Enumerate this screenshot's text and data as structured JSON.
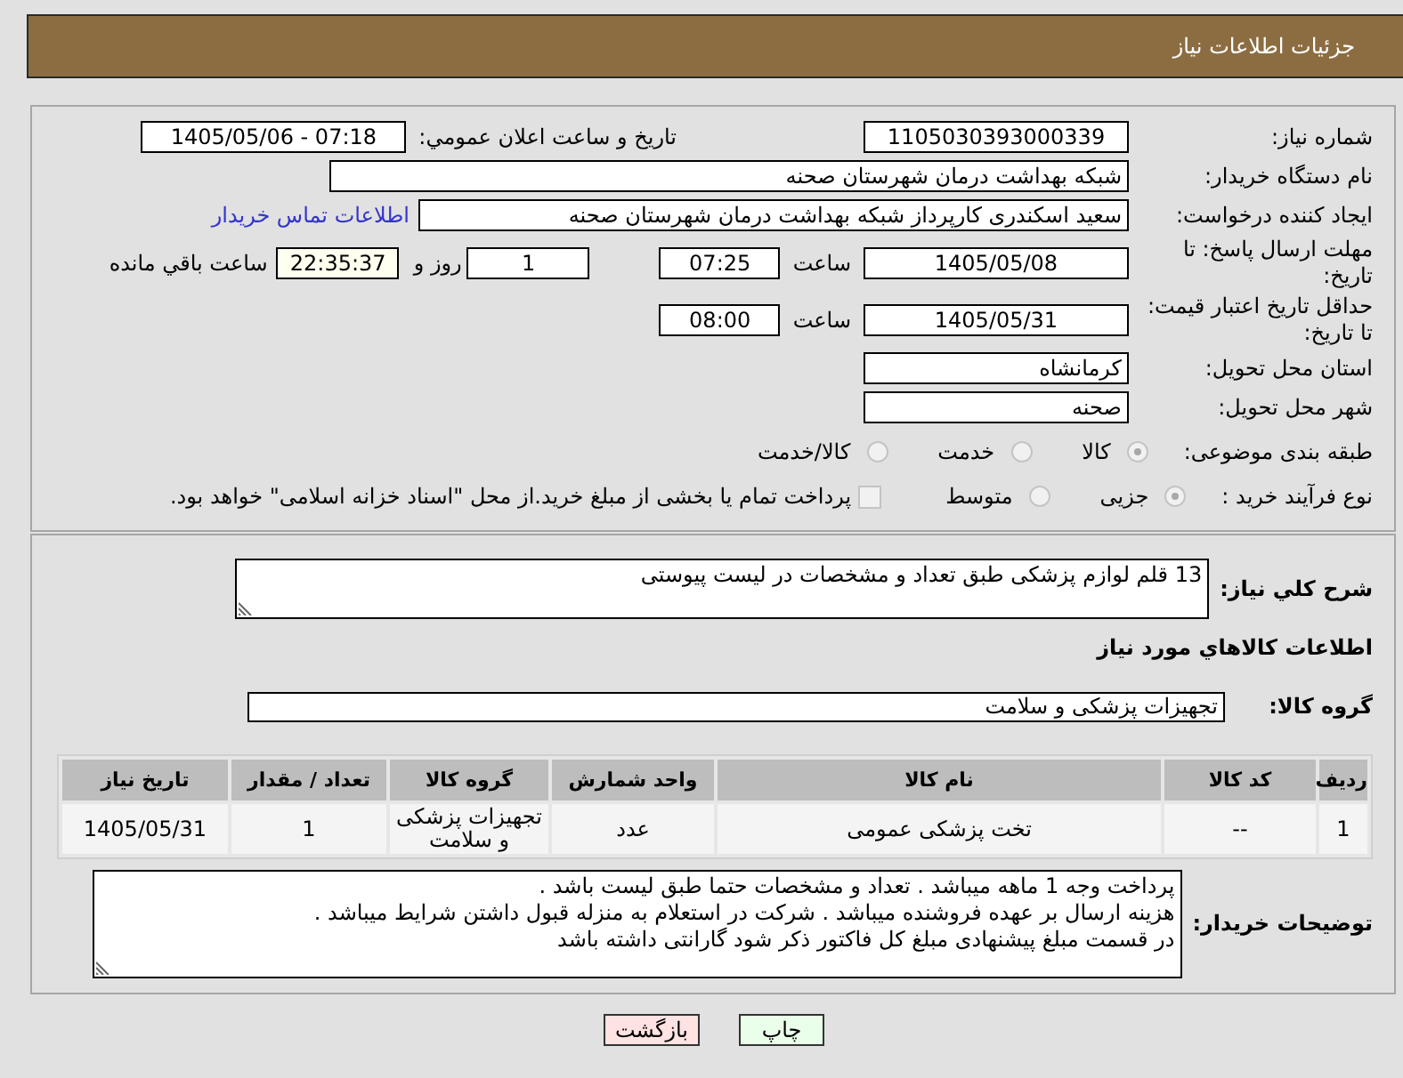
{
  "header": {
    "title": "جزئیات اطلاعات نیاز"
  },
  "need_info": {
    "need_number": {
      "label": "شماره نیاز:",
      "value": "1105030393000339"
    },
    "announcement": {
      "label": "تاریخ و ساعت اعلان عمومي:",
      "value": "1405/05/06 - 07:18"
    },
    "buyer_org": {
      "label": "نام دستگاه خریدار:",
      "value": "شبکه بهداشت درمان شهرستان صحنه"
    },
    "requester": {
      "label": "ایجاد کننده درخواست:",
      "value": "سعید اسکندری کارپرداز شبکه بهداشت درمان شهرستان صحنه",
      "contact_link": "اطلاعات تماس خریدار"
    },
    "reply_deadline": {
      "label": "مهلت ارسال پاسخ: تا تاریخ:",
      "date": "1405/05/08",
      "time_label": "ساعت",
      "time": "07:25",
      "days": "1",
      "days_label": "روز و",
      "remaining": "22:35:37",
      "remaining_label": "ساعت باقي مانده"
    },
    "price_validity": {
      "label": "حداقل تاریخ اعتبار قیمت: تا تاریخ:",
      "date": "1405/05/31",
      "time_label": "ساعت",
      "time": "08:00"
    },
    "delivery_province": {
      "label": "استان محل تحویل:",
      "value": "کرمانشاه"
    },
    "delivery_city": {
      "label": "شهر محل تحویل:",
      "value": "صحنه"
    },
    "category": {
      "label": "طبقه بندی موضوعی:",
      "options": [
        {
          "label": "کالا",
          "selected": true,
          "disabled": true
        },
        {
          "label": "خدمت",
          "selected": false,
          "disabled": true
        },
        {
          "label": "کالا/خدمت",
          "selected": false,
          "disabled": true
        }
      ]
    },
    "purchase_process": {
      "label": "نوع فرآیند خرید :",
      "options": [
        {
          "label": "جزیی",
          "selected": true,
          "disabled": true
        },
        {
          "label": "متوسط",
          "selected": false,
          "disabled": true
        }
      ],
      "treasury": {
        "label": "پرداخت تمام یا بخشی از مبلغ خرید.از محل \"اسناد خزانه اسلامی\" خواهد بود.",
        "checked": false,
        "disabled": true
      }
    }
  },
  "goods": {
    "summary": {
      "label": "شرح کلي نیاز:",
      "value": "13 قلم لوازم پزشکی طبق تعداد و مشخصات در لیست پیوستی"
    },
    "heading": "اطلاعات کالاهاي مورد نیاز",
    "goods_group": {
      "label": "گروه کالا:",
      "value": "تجهیزات پزشکی و سلامت"
    },
    "table": {
      "columns": [
        "ردیف",
        "کد کالا",
        "نام کالا",
        "واحد شمارش",
        "گروه کالا",
        "تعداد / مقدار",
        "تاریخ نیاز"
      ],
      "rows": [
        [
          "1",
          "--",
          "تخت پزشکی عمومی",
          "عدد",
          "تجهیزات پزشکی و سلامت",
          "1",
          "1405/05/31"
        ]
      ]
    },
    "buyer_notes": {
      "label": "توضیحات خریدار:",
      "value": "پرداخت وجه 1 ماهه میباشد . تعداد و مشخصات حتما طبق لیست باشد .\nهزینه ارسال بر عهده فروشنده میباشد . شرکت در استعلام به منزله قبول داشتن شرایط میباشد .\nدر قسمت مبلغ پیشنهادی مبلغ کل فاکتور ذکر شود  گارانتی داشته باشد"
    }
  },
  "buttons": [
    {
      "kind": "print",
      "label": "چاپ"
    },
    {
      "kind": "back",
      "label": "بازگشت"
    }
  ]
}
